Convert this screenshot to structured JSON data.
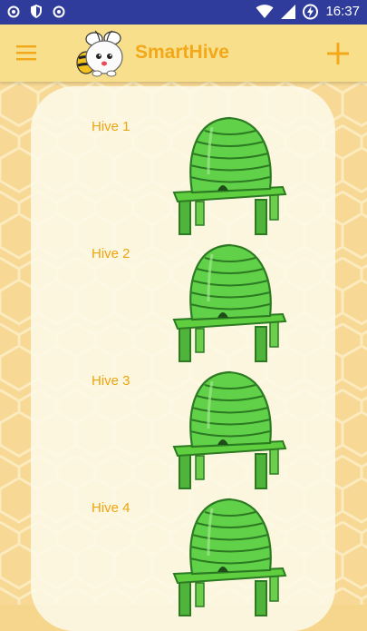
{
  "status_bar": {
    "time": "16:37",
    "left_icons": [
      "target-notification-icon",
      "shield-icon",
      "target-notification-icon"
    ],
    "right_icons": [
      "wifi-icon",
      "signal-icon",
      "battery-charging-icon"
    ]
  },
  "app_bar": {
    "title": "SmartHive",
    "menu_icon": "hamburger-menu-icon",
    "logo": "bee-logo",
    "action_icon": "plus-icon"
  },
  "hives": [
    {
      "label": "Hive 1"
    },
    {
      "label": "Hive 2"
    },
    {
      "label": "Hive 3"
    },
    {
      "label": "Hive 4"
    }
  ],
  "colors": {
    "status_bar": "#2f3c9b",
    "app_bar": "#f8df8c",
    "accent": "#f2a818",
    "hive_green": "#5fcf3f",
    "honeycomb": "#f6d58c"
  }
}
